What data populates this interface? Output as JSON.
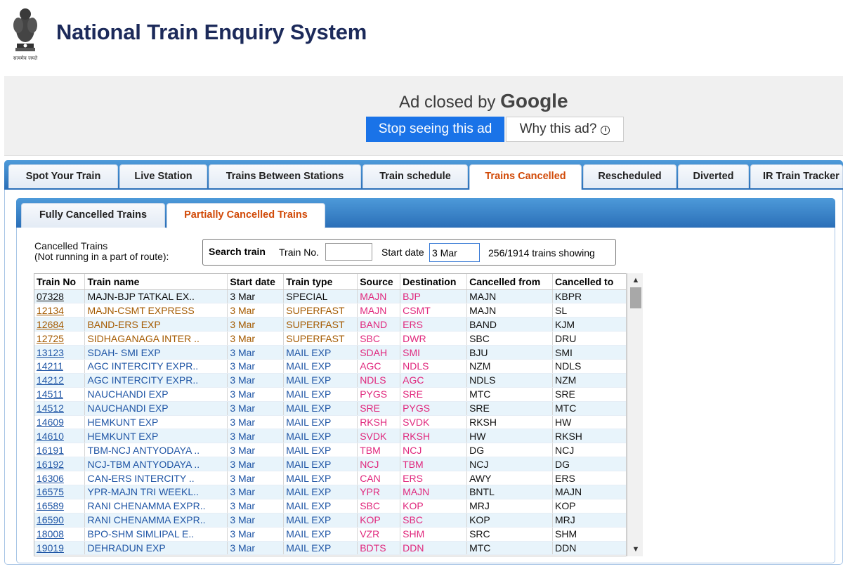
{
  "header": {
    "title": "National Train Enquiry System",
    "emblem_caption": "सत्यमेव जयते"
  },
  "ad": {
    "closed_prefix": "Ad closed by",
    "closed_brand": "Google",
    "stop_label": "Stop seeing this ad",
    "why_label": "Why this ad?"
  },
  "main_tabs": [
    {
      "label": "Spot Your Train"
    },
    {
      "label": "Live Station"
    },
    {
      "label": "Trains Between Stations"
    },
    {
      "label": "Train schedule"
    },
    {
      "label": "Trains Cancelled"
    },
    {
      "label": "Rescheduled"
    },
    {
      "label": "Diverted"
    },
    {
      "label": "IR Train Tracker"
    }
  ],
  "sub_tabs": [
    {
      "label": "Fully Cancelled Trains"
    },
    {
      "label": "Partially Cancelled Trains"
    }
  ],
  "note": {
    "line1": "Cancelled Trains",
    "line2": "(Not running in a part of route):"
  },
  "search": {
    "label": "Search train",
    "train_no_label": "Train No.",
    "train_no_value": "",
    "start_date_label": "Start date",
    "start_date_value": "3 Mar",
    "count_text": "256/1914 trains showing"
  },
  "table": {
    "headers": [
      "Train No",
      "Train name",
      "Start date",
      "Train type",
      "Source",
      "Destination",
      "Cancelled from",
      "Cancelled to"
    ],
    "rows": [
      {
        "no": "07328",
        "name": "MAJN-BJP TATKAL EX..",
        "date": "3 Mar",
        "type": "SPECIAL",
        "src": "MAJN",
        "dst": "BJP",
        "from": "MAJN",
        "to": "KBPR",
        "tone": "black"
      },
      {
        "no": "12134",
        "name": "MAJN-CSMT EXPRESS",
        "date": "3 Mar",
        "type": "SUPERFAST",
        "src": "MAJN",
        "dst": "CSMT",
        "from": "MAJN",
        "to": "SL",
        "tone": "brown"
      },
      {
        "no": "12684",
        "name": "BAND-ERS EXP",
        "date": "3 Mar",
        "type": "SUPERFAST",
        "src": "BAND",
        "dst": "ERS",
        "from": "BAND",
        "to": "KJM",
        "tone": "brown"
      },
      {
        "no": "12725",
        "name": "SIDHAGANAGA INTER ..",
        "date": "3 Mar",
        "type": "SUPERFAST",
        "src": "SBC",
        "dst": "DWR",
        "from": "SBC",
        "to": "DRU",
        "tone": "brown"
      },
      {
        "no": "13123",
        "name": "SDAH- SMI EXP",
        "date": "3 Mar",
        "type": "MAIL EXP",
        "src": "SDAH",
        "dst": "SMI",
        "from": "BJU",
        "to": "SMI",
        "tone": "blue"
      },
      {
        "no": "14211",
        "name": "AGC INTERCITY EXPR..",
        "date": "3 Mar",
        "type": "MAIL EXP",
        "src": "AGC",
        "dst": "NDLS",
        "from": "NZM",
        "to": "NDLS",
        "tone": "blue"
      },
      {
        "no": "14212",
        "name": "AGC INTERCITY EXPR..",
        "date": "3 Mar",
        "type": "MAIL EXP",
        "src": "NDLS",
        "dst": "AGC",
        "from": "NDLS",
        "to": "NZM",
        "tone": "blue"
      },
      {
        "no": "14511",
        "name": "NAUCHANDI EXP",
        "date": "3 Mar",
        "type": "MAIL EXP",
        "src": "PYGS",
        "dst": "SRE",
        "from": "MTC",
        "to": "SRE",
        "tone": "blue"
      },
      {
        "no": "14512",
        "name": "NAUCHANDI EXP",
        "date": "3 Mar",
        "type": "MAIL EXP",
        "src": "SRE",
        "dst": "PYGS",
        "from": "SRE",
        "to": "MTC",
        "tone": "blue"
      },
      {
        "no": "14609",
        "name": "HEMKUNT EXP",
        "date": "3 Mar",
        "type": "MAIL EXP",
        "src": "RKSH",
        "dst": "SVDK",
        "from": "RKSH",
        "to": "HW",
        "tone": "blue"
      },
      {
        "no": "14610",
        "name": "HEMKUNT EXP",
        "date": "3 Mar",
        "type": "MAIL EXP",
        "src": "SVDK",
        "dst": "RKSH",
        "from": "HW",
        "to": "RKSH",
        "tone": "blue"
      },
      {
        "no": "16191",
        "name": "TBM-NCJ ANTYODAYA ..",
        "date": "3 Mar",
        "type": "MAIL EXP",
        "src": "TBM",
        "dst": "NCJ",
        "from": "DG",
        "to": "NCJ",
        "tone": "blue"
      },
      {
        "no": "16192",
        "name": "NCJ-TBM ANTYODAYA ..",
        "date": "3 Mar",
        "type": "MAIL EXP",
        "src": "NCJ",
        "dst": "TBM",
        "from": "NCJ",
        "to": "DG",
        "tone": "blue"
      },
      {
        "no": "16306",
        "name": "CAN-ERS INTERCITY ..",
        "date": "3 Mar",
        "type": "MAIL EXP",
        "src": "CAN",
        "dst": "ERS",
        "from": "AWY",
        "to": "ERS",
        "tone": "blue"
      },
      {
        "no": "16575",
        "name": "YPR-MAJN TRI WEEKL..",
        "date": "3 Mar",
        "type": "MAIL EXP",
        "src": "YPR",
        "dst": "MAJN",
        "from": "BNTL",
        "to": "MAJN",
        "tone": "blue"
      },
      {
        "no": "16589",
        "name": "RANI CHENAMMA EXPR..",
        "date": "3 Mar",
        "type": "MAIL EXP",
        "src": "SBC",
        "dst": "KOP",
        "from": "MRJ",
        "to": "KOP",
        "tone": "blue"
      },
      {
        "no": "16590",
        "name": "RANI CHENAMMA EXPR..",
        "date": "3 Mar",
        "type": "MAIL EXP",
        "src": "KOP",
        "dst": "SBC",
        "from": "KOP",
        "to": "MRJ",
        "tone": "blue"
      },
      {
        "no": "18008",
        "name": "BPO-SHM SIMLIPAL E..",
        "date": "3 Mar",
        "type": "MAIL EXP",
        "src": "VZR",
        "dst": "SHM",
        "from": "SRC",
        "to": "SHM",
        "tone": "blue"
      },
      {
        "no": "19019",
        "name": "DEHRADUN EXP",
        "date": "3 Mar",
        "type": "MAIL EXP",
        "src": "BDTS",
        "dst": "DDN",
        "from": "MTC",
        "to": "DDN",
        "tone": "blue"
      }
    ]
  },
  "colors": {
    "title": "#1c2a5a",
    "tab_active": "#d14a08",
    "tab_strip": "#2b6fb8",
    "link_blue": "#1f55a5",
    "superfast_brown": "#a45a00",
    "station_pink": "#e0287d",
    "row_alt": "#e8f4fb",
    "ad_button": "#1a73e8"
  },
  "icons": {
    "emblem": "ashoka-emblem-icon",
    "info": "info-icon",
    "scroll_up": "triangle-up-icon",
    "scroll_down": "triangle-down-icon"
  }
}
